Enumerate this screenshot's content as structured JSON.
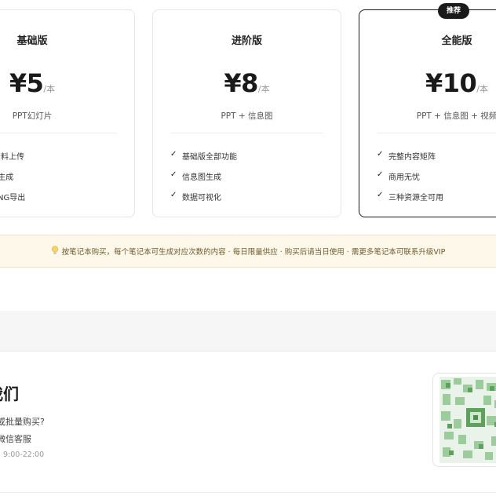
{
  "plans": [
    {
      "title": "基础版",
      "price": "¥5",
      "unit": "/本",
      "desc": "PPT幻灯片",
      "features": [
        "资料上传",
        "T生成",
        "PNG导出"
      ]
    },
    {
      "title": "进阶版",
      "price": "¥8",
      "unit": "/本",
      "desc": "PPT + 信息图",
      "features": [
        "基础版全部功能",
        "信息图生成",
        "数据可视化"
      ]
    },
    {
      "title": "全能版",
      "badge": "推荐",
      "price": "¥10",
      "unit": "/本",
      "desc": "PPT + 信息图 + 视频",
      "features": [
        "完整内容矩阵",
        "商用无忧",
        "三种资源全可用"
      ]
    }
  ],
  "notice": {
    "icon": "lightbulb-icon",
    "text": "按笔记本购买，每个笔记本可生成对应次数的内容 · 每日限量供应 · 购买后请当日使用 · 需更多笔记本可联系升级VIP"
  },
  "contact": {
    "title": "我们",
    "line1": "或批量购买?",
    "line2": "微信客服",
    "hours": "9:00-22:00",
    "qr_icon": "wechat-qr-code"
  },
  "colors": {
    "accent_dark": "#1a1a1a",
    "notice_bg": "#fdf8ea",
    "qr_green": "#5da15d"
  }
}
